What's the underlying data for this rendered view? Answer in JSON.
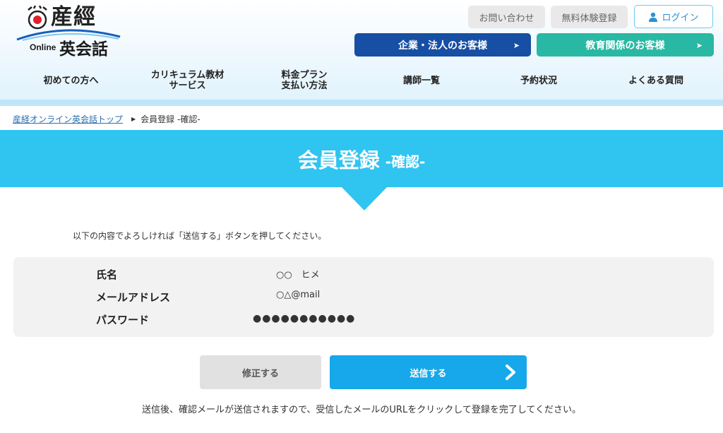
{
  "header": {
    "logo": {
      "brand": "産經",
      "online": "Online",
      "eikaiwa": "英会話"
    },
    "top_links": {
      "contact": "お問い合わせ",
      "trial": "無料体験登録",
      "login": "ログイン"
    },
    "audience_buttons": {
      "corporate": "企業・法人のお客様",
      "education": "教育関係のお客様",
      "arrow": "➤"
    },
    "nav": [
      {
        "label": "初めての方へ"
      },
      {
        "label_line1": "カリキュラム教材",
        "label_line2": "サービス"
      },
      {
        "label_line1": "料金プラン",
        "label_line2": "支払い方法"
      },
      {
        "label": "講師一覧"
      },
      {
        "label": "予約状況"
      },
      {
        "label": "よくある質問"
      }
    ]
  },
  "breadcrumb": {
    "home": "産経オンライン英会話トップ",
    "separator": "▶",
    "current": "会員登録 -確認-"
  },
  "page_title": {
    "main": "会員登録",
    "sub": "-確認-"
  },
  "instruction": "以下の内容でよろしければ「送信する」ボタンを押してください。",
  "confirm": {
    "name": {
      "label": "氏名",
      "value": "○○　ヒメ"
    },
    "email": {
      "label": "メールアドレス",
      "value": "○△@mail"
    },
    "password": {
      "label": "パスワード",
      "value": "●●●●●●●●●●●"
    }
  },
  "actions": {
    "edit": "修正する",
    "send": "送信する"
  },
  "footnote": "送信後、確認メールが送信されますので、受信したメールのURLをクリックして登録を完了してください。",
  "colors": {
    "accent": "#30c4f1",
    "send": "#16a8ea",
    "corporate": "#164fa3",
    "education": "#29b8a3"
  }
}
